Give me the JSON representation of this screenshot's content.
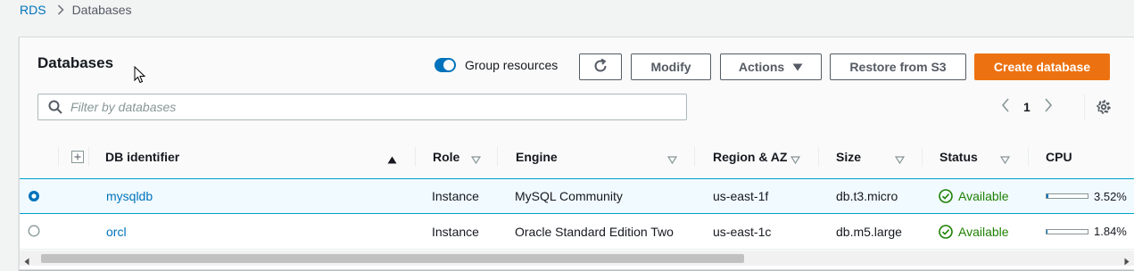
{
  "breadcrumb": {
    "root": "RDS",
    "current": "Databases"
  },
  "panel": {
    "title": "Databases"
  },
  "toolbar": {
    "group_resources_label": "Group resources",
    "group_resources_on": true,
    "modify_label": "Modify",
    "actions_label": "Actions",
    "restore_label": "Restore from S3",
    "create_label": "Create database"
  },
  "filter": {
    "placeholder": "Filter by databases",
    "value": ""
  },
  "pagination": {
    "current_page": "1"
  },
  "table": {
    "columns": [
      "DB identifier",
      "Role",
      "Engine",
      "Region & AZ",
      "Size",
      "Status",
      "CPU"
    ],
    "rows": [
      {
        "identifier": "mysqldb",
        "role": "Instance",
        "engine": "MySQL Community",
        "region": "us-east-1f",
        "size": "db.t3.micro",
        "status": "Available",
        "cpu": "3.52%",
        "cpu_fraction": 0.0352,
        "selected": true
      },
      {
        "identifier": "orcl",
        "role": "Instance",
        "engine": "Oracle Standard Edition Two",
        "region": "us-east-1c",
        "size": "db.m5.large",
        "status": "Available",
        "cpu": "1.84%",
        "cpu_fraction": 0.0184,
        "selected": false
      }
    ]
  },
  "colors": {
    "accent": "#0073bb",
    "primary_button": "#ec7211",
    "status_ok": "#1d8102"
  },
  "icons": [
    "chevron-right-icon",
    "cursor-icon",
    "refresh-icon",
    "caret-down-icon",
    "search-icon",
    "chevron-left-icon",
    "gear-icon",
    "expand-icon",
    "sort-asc-icon",
    "sort-icon",
    "radio-selected-icon",
    "radio-icon",
    "check-circle-icon"
  ]
}
